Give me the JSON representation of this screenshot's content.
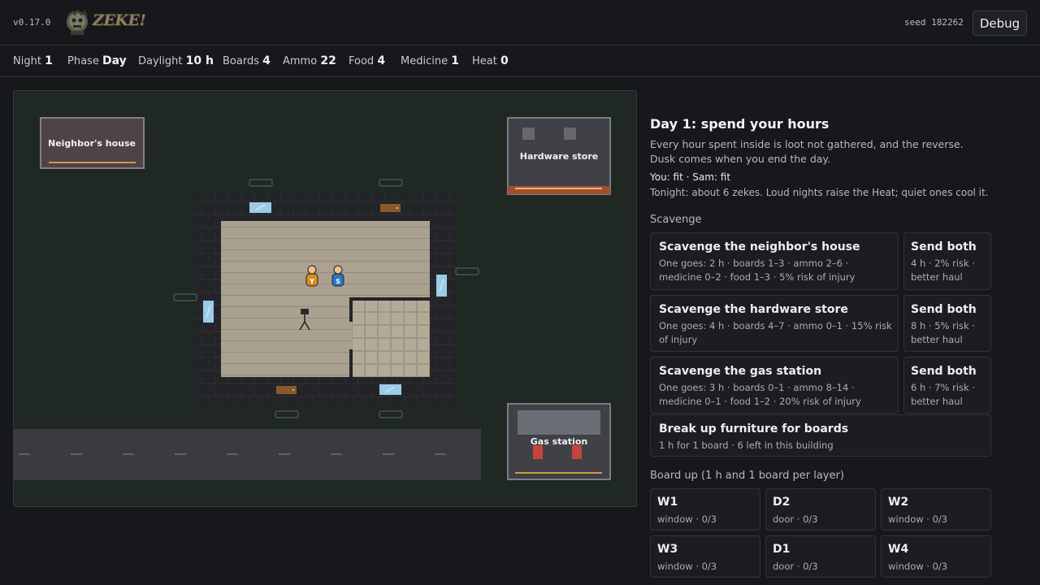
{
  "header": {
    "version": "v0.17.0",
    "logo_text": "ZEKE!",
    "seed": "seed 182262",
    "debug_label": "Debug"
  },
  "stats": [
    {
      "label": "Night",
      "value": "1"
    },
    {
      "label": "Phase",
      "value": "Day"
    },
    {
      "label": "Daylight",
      "value": "10 h"
    },
    {
      "label": "Boards",
      "value": "4"
    },
    {
      "label": "Ammo",
      "value": "22"
    },
    {
      "label": "Food",
      "value": "4"
    },
    {
      "label": "Medicine",
      "value": "1"
    },
    {
      "label": "Heat",
      "value": "0"
    }
  ],
  "map": {
    "neighbor_label": "Neighbor's house",
    "hardware_label": "Hardware store",
    "gas_label": "Gas station",
    "player_you": "Y",
    "player_sam": "S",
    "colors": {
      "grass": "#1f2822",
      "floor": "#ada494",
      "wall": "#262729",
      "road": "#3a3b40",
      "window": "#9ccbe6",
      "door": "#8a5a2e"
    }
  },
  "panel": {
    "title": "Day 1: spend your hours",
    "intro": "Every hour spent inside is loot not gathered, and the reverse. Dusk comes when you end the day.",
    "status_line": "You: fit · Sam: fit",
    "tonight": "Tonight: about 6 zekes. Loud nights raise the Heat; quiet ones cool it.",
    "scavenge_heading": "Scavenge",
    "scavenge": [
      {
        "title": "Scavenge the neighbor's house",
        "desc": "One goes: 2 h · boards 1–3 · ammo 2–6 · medicine 0–2 · food 1–3 · 5% risk of injury",
        "both_title": "Send both",
        "both_desc": "4 h · 2% risk · better haul"
      },
      {
        "title": "Scavenge the hardware store",
        "desc": "One goes: 4 h · boards 4–7 · ammo 0–1 · 15% risk of injury",
        "both_title": "Send both",
        "both_desc": "8 h · 5% risk · better haul"
      },
      {
        "title": "Scavenge the gas station",
        "desc": "One goes: 3 h · boards 0–1 · ammo 8–14 · medicine 0–1 · food 1–2 · 20% risk of injury",
        "both_title": "Send both",
        "both_desc": "6 h · 7% risk · better haul"
      }
    ],
    "furniture": {
      "title": "Break up furniture for boards",
      "desc": "1 h for 1 board · 6 left in this building"
    },
    "boardup_heading": "Board up (1 h and 1 board per layer)",
    "boardup": [
      {
        "title": "W1",
        "desc": "window · 0/3"
      },
      {
        "title": "D2",
        "desc": "door · 0/3"
      },
      {
        "title": "W2",
        "desc": "window · 0/3"
      },
      {
        "title": "W3",
        "desc": "window · 0/3"
      },
      {
        "title": "D1",
        "desc": "door · 0/3"
      },
      {
        "title": "W4",
        "desc": "window · 0/3"
      }
    ]
  }
}
